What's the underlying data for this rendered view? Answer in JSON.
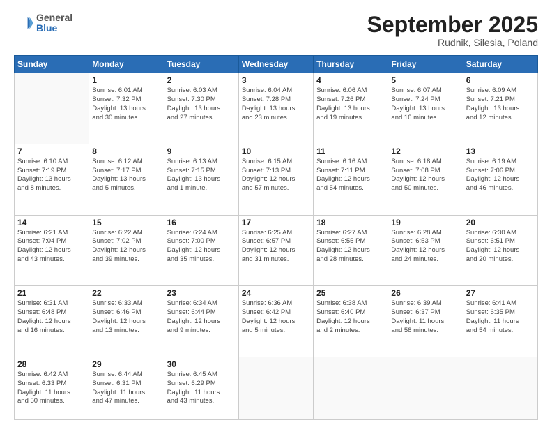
{
  "header": {
    "logo_general": "General",
    "logo_blue": "Blue",
    "month": "September 2025",
    "location": "Rudnik, Silesia, Poland"
  },
  "weekdays": [
    "Sunday",
    "Monday",
    "Tuesday",
    "Wednesday",
    "Thursday",
    "Friday",
    "Saturday"
  ],
  "weeks": [
    [
      {
        "day": "",
        "info": ""
      },
      {
        "day": "1",
        "info": "Sunrise: 6:01 AM\nSunset: 7:32 PM\nDaylight: 13 hours\nand 30 minutes."
      },
      {
        "day": "2",
        "info": "Sunrise: 6:03 AM\nSunset: 7:30 PM\nDaylight: 13 hours\nand 27 minutes."
      },
      {
        "day": "3",
        "info": "Sunrise: 6:04 AM\nSunset: 7:28 PM\nDaylight: 13 hours\nand 23 minutes."
      },
      {
        "day": "4",
        "info": "Sunrise: 6:06 AM\nSunset: 7:26 PM\nDaylight: 13 hours\nand 19 minutes."
      },
      {
        "day": "5",
        "info": "Sunrise: 6:07 AM\nSunset: 7:24 PM\nDaylight: 13 hours\nand 16 minutes."
      },
      {
        "day": "6",
        "info": "Sunrise: 6:09 AM\nSunset: 7:21 PM\nDaylight: 13 hours\nand 12 minutes."
      }
    ],
    [
      {
        "day": "7",
        "info": "Sunrise: 6:10 AM\nSunset: 7:19 PM\nDaylight: 13 hours\nand 8 minutes."
      },
      {
        "day": "8",
        "info": "Sunrise: 6:12 AM\nSunset: 7:17 PM\nDaylight: 13 hours\nand 5 minutes."
      },
      {
        "day": "9",
        "info": "Sunrise: 6:13 AM\nSunset: 7:15 PM\nDaylight: 13 hours\nand 1 minute."
      },
      {
        "day": "10",
        "info": "Sunrise: 6:15 AM\nSunset: 7:13 PM\nDaylight: 12 hours\nand 57 minutes."
      },
      {
        "day": "11",
        "info": "Sunrise: 6:16 AM\nSunset: 7:11 PM\nDaylight: 12 hours\nand 54 minutes."
      },
      {
        "day": "12",
        "info": "Sunrise: 6:18 AM\nSunset: 7:08 PM\nDaylight: 12 hours\nand 50 minutes."
      },
      {
        "day": "13",
        "info": "Sunrise: 6:19 AM\nSunset: 7:06 PM\nDaylight: 12 hours\nand 46 minutes."
      }
    ],
    [
      {
        "day": "14",
        "info": "Sunrise: 6:21 AM\nSunset: 7:04 PM\nDaylight: 12 hours\nand 43 minutes."
      },
      {
        "day": "15",
        "info": "Sunrise: 6:22 AM\nSunset: 7:02 PM\nDaylight: 12 hours\nand 39 minutes."
      },
      {
        "day": "16",
        "info": "Sunrise: 6:24 AM\nSunset: 7:00 PM\nDaylight: 12 hours\nand 35 minutes."
      },
      {
        "day": "17",
        "info": "Sunrise: 6:25 AM\nSunset: 6:57 PM\nDaylight: 12 hours\nand 31 minutes."
      },
      {
        "day": "18",
        "info": "Sunrise: 6:27 AM\nSunset: 6:55 PM\nDaylight: 12 hours\nand 28 minutes."
      },
      {
        "day": "19",
        "info": "Sunrise: 6:28 AM\nSunset: 6:53 PM\nDaylight: 12 hours\nand 24 minutes."
      },
      {
        "day": "20",
        "info": "Sunrise: 6:30 AM\nSunset: 6:51 PM\nDaylight: 12 hours\nand 20 minutes."
      }
    ],
    [
      {
        "day": "21",
        "info": "Sunrise: 6:31 AM\nSunset: 6:48 PM\nDaylight: 12 hours\nand 16 minutes."
      },
      {
        "day": "22",
        "info": "Sunrise: 6:33 AM\nSunset: 6:46 PM\nDaylight: 12 hours\nand 13 minutes."
      },
      {
        "day": "23",
        "info": "Sunrise: 6:34 AM\nSunset: 6:44 PM\nDaylight: 12 hours\nand 9 minutes."
      },
      {
        "day": "24",
        "info": "Sunrise: 6:36 AM\nSunset: 6:42 PM\nDaylight: 12 hours\nand 5 minutes."
      },
      {
        "day": "25",
        "info": "Sunrise: 6:38 AM\nSunset: 6:40 PM\nDaylight: 12 hours\nand 2 minutes."
      },
      {
        "day": "26",
        "info": "Sunrise: 6:39 AM\nSunset: 6:37 PM\nDaylight: 11 hours\nand 58 minutes."
      },
      {
        "day": "27",
        "info": "Sunrise: 6:41 AM\nSunset: 6:35 PM\nDaylight: 11 hours\nand 54 minutes."
      }
    ],
    [
      {
        "day": "28",
        "info": "Sunrise: 6:42 AM\nSunset: 6:33 PM\nDaylight: 11 hours\nand 50 minutes."
      },
      {
        "day": "29",
        "info": "Sunrise: 6:44 AM\nSunset: 6:31 PM\nDaylight: 11 hours\nand 47 minutes."
      },
      {
        "day": "30",
        "info": "Sunrise: 6:45 AM\nSunset: 6:29 PM\nDaylight: 11 hours\nand 43 minutes."
      },
      {
        "day": "",
        "info": ""
      },
      {
        "day": "",
        "info": ""
      },
      {
        "day": "",
        "info": ""
      },
      {
        "day": "",
        "info": ""
      }
    ]
  ]
}
